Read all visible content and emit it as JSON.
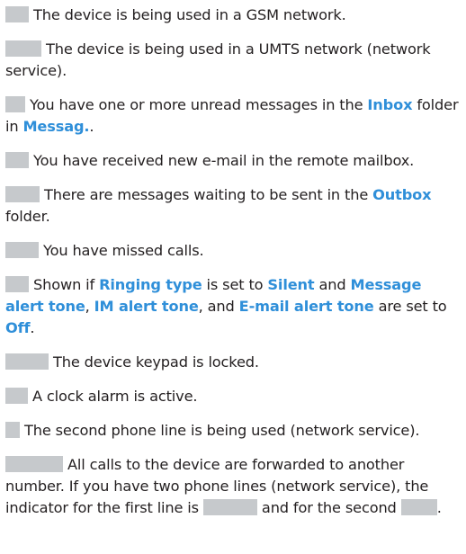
{
  "paragraphs": [
    {
      "icon": "gsm-network-icon",
      "parts": [
        {
          "t": "The device is being used in a GSM network."
        }
      ]
    },
    {
      "icon": "umts-network-icon",
      "parts": [
        {
          "t": "The device is being used in a UMTS network (network service)."
        }
      ]
    },
    {
      "icon": "unread-messages-icon",
      "parts": [
        {
          "t": "You have one or more unread messages in the "
        },
        {
          "t": "Inbox",
          "hl": true
        },
        {
          "t": " folder in "
        },
        {
          "t": "Messag.",
          "hl": true
        },
        {
          "t": "."
        }
      ]
    },
    {
      "icon": "new-email-icon",
      "parts": [
        {
          "t": "You have received new e-mail in the remote mailbox."
        }
      ]
    },
    {
      "icon": "outbox-messages-icon",
      "parts": [
        {
          "t": "There are messages waiting to be sent in the "
        },
        {
          "t": "Outbox",
          "hl": true
        },
        {
          "t": " folder."
        }
      ]
    },
    {
      "icon": "missed-calls-icon",
      "parts": [
        {
          "t": "You have missed calls."
        }
      ]
    },
    {
      "icon": "silent-profile-icon",
      "parts": [
        {
          "t": "Shown if "
        },
        {
          "t": "Ringing type",
          "hl": true
        },
        {
          "t": " is set to "
        },
        {
          "t": "Silent",
          "hl": true
        },
        {
          "t": " and "
        },
        {
          "t": "Message alert tone",
          "hl": true
        },
        {
          "t": ", "
        },
        {
          "t": "IM alert tone",
          "hl": true
        },
        {
          "t": ", and "
        },
        {
          "t": "E-mail alert tone",
          "hl": true
        },
        {
          "t": " are set to "
        },
        {
          "t": "Off",
          "hl": true
        },
        {
          "t": "."
        }
      ]
    },
    {
      "icon": "keypad-locked-icon",
      "parts": [
        {
          "t": "The device keypad is locked."
        }
      ]
    },
    {
      "icon": "clock-alarm-icon",
      "parts": [
        {
          "t": "A clock alarm is active."
        }
      ]
    },
    {
      "icon": "second-phone-line-icon",
      "parts": [
        {
          "t": "The second phone line is being used (network service)."
        }
      ]
    },
    {
      "icon": "call-forwarding-icon",
      "parts": [
        {
          "t": "All calls to the device are forwarded to another number. If you have two phone lines (network service), the indicator for the first line is "
        },
        {
          "icon": "call-forwarding-line1-icon"
        },
        {
          "t": " and for the second "
        },
        {
          "icon": "call-forwarding-line2-icon"
        },
        {
          "t": "."
        }
      ]
    }
  ]
}
